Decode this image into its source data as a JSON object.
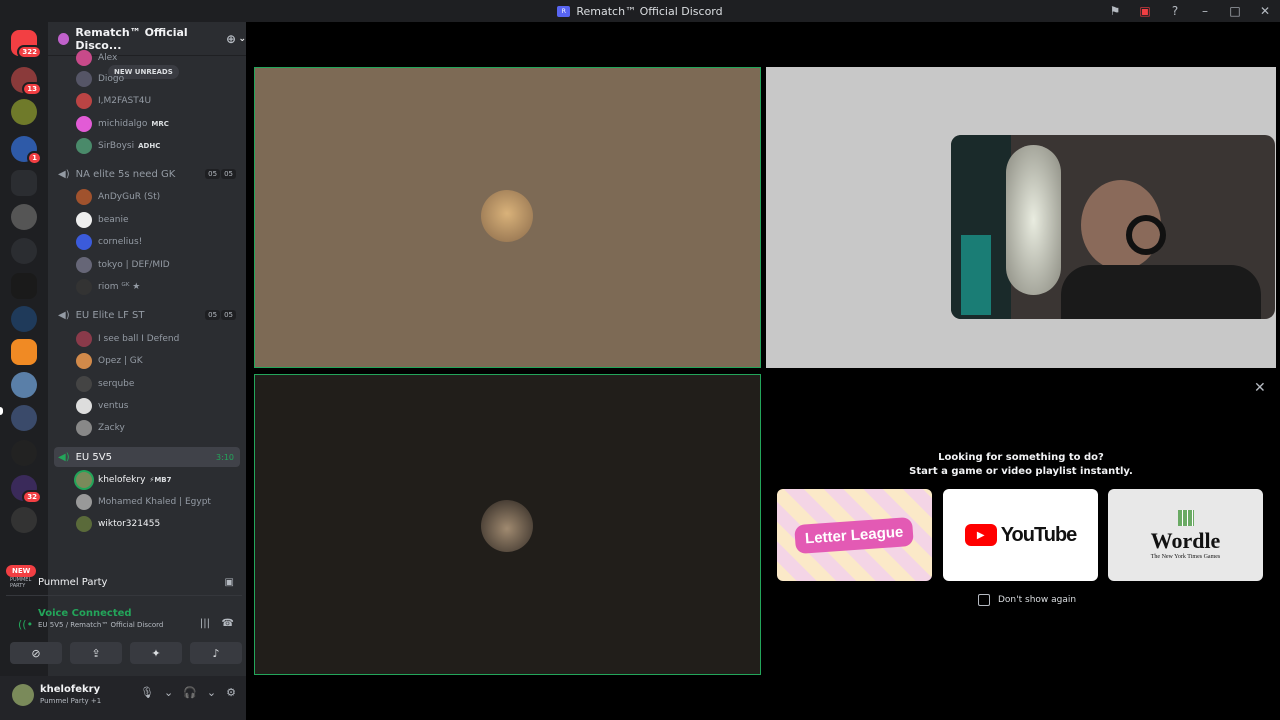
{
  "window": {
    "title": "Rematch™ Official Discord"
  },
  "rail": {
    "badges": {
      "dm": "322",
      "s1": "13",
      "s2": "1",
      "s3": "32"
    },
    "new_label": "NEW"
  },
  "server": {
    "name": "Rematch™ Official Disco...",
    "new_unreads": "NEW UNREADS"
  },
  "channels": [
    {
      "name": "NA elite 5s need GK",
      "c1": "05",
      "c2": "05"
    },
    {
      "name": "EU Elite LF ST",
      "c1": "05",
      "c2": "05"
    },
    {
      "name": "EU 5V5",
      "time": "3:10"
    }
  ],
  "users": {
    "alex": "Alex",
    "diogo": "Diogo",
    "m2fast": "I,M2FAST4U",
    "michidalgo": "michidalgo",
    "michidalgo_tag": "MRC",
    "sirboysi": "SirBoysi",
    "sirboysi_tag": "ADHC",
    "andygur": "AnDyGuR (St)",
    "beanie": "beanie",
    "cornelius": "cornelius!",
    "tokyo": "tokyo | DEF/MID",
    "riom": "riom ᴳᴷ ★",
    "iseeball": "I see ball I Defend",
    "opez": "Opez | GK",
    "serqube": "serqube",
    "ventus": "ventus",
    "zacky": "Zacky",
    "khelofekry": "khelofekry",
    "khelofekry_tag": "⚡MB7",
    "mohamed": "Mohamed Khaled | Egypt",
    "wiktor": "wiktor321455"
  },
  "activity": {
    "name": "Pummel Party",
    "logo": "PUMMEL PARTY"
  },
  "voice": {
    "status": "Voice Connected",
    "channel": "EU 5V5 / Rematch™ Official Discord"
  },
  "userbar": {
    "name": "khelofekry",
    "status": "Pummel Party +1"
  },
  "stage": {
    "prompt_line1": "Looking for something to do?",
    "prompt_line2": "Start a game or video playlist instantly.",
    "dont_show": "Don't show again"
  },
  "cards": {
    "letter": "Letter League",
    "youtube": "YouTube",
    "wordle": "Wordle",
    "wordle_sub": "The New York Times Games"
  },
  "colors": {
    "accent": "#5865f2",
    "online": "#23a55a",
    "danger": "#f23f43"
  }
}
